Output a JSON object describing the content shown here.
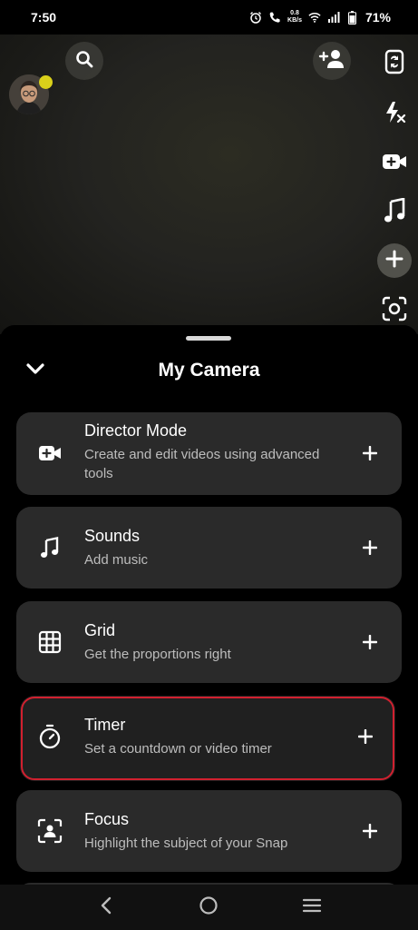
{
  "status_bar": {
    "time": "7:50",
    "net_speed_value": "0.8",
    "net_speed_unit": "KB/s",
    "battery": "71%"
  },
  "camera_toolbar": {
    "avatar": "bitmoji-avatar",
    "notification_dot_color": "#d9d01a",
    "icons": [
      "search-icon",
      "add-friend-icon",
      "flip-camera-icon",
      "flash-off-icon",
      "director-mode-icon",
      "music-note-icon",
      "plus-icon",
      "scan-icon"
    ]
  },
  "sheet": {
    "title": "My Camera",
    "items": [
      {
        "title": "Director Mode",
        "desc": "Create and edit videos using advanced tools",
        "icon": "video-plus-icon"
      },
      {
        "title": "Sounds",
        "desc": "Add music",
        "icon": "music-note-icon"
      },
      {
        "title": "Grid",
        "desc": "Get the proportions right",
        "icon": "grid-icon"
      },
      {
        "title": "Timer",
        "desc": "Set a countdown or video timer",
        "icon": "stopwatch-icon",
        "highlighted": true
      },
      {
        "title": "Focus",
        "desc": "Highlight the subject of your Snap",
        "icon": "focus-icon"
      }
    ]
  },
  "highlight_color": "#d1202f"
}
